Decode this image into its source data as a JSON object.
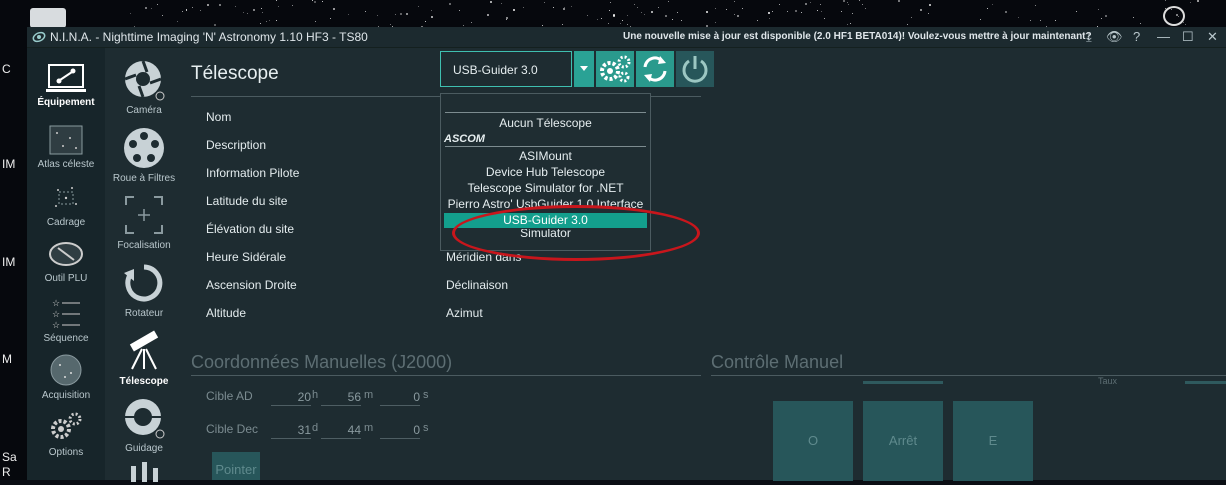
{
  "window": {
    "title": "N.I.N.A. - Nighttime Imaging 'N' Astronomy 1.10 HF3   -  TS80",
    "update_notice": "Une nouvelle mise à jour est disponible (2.0 HF1 BETA014)! Voulez-vous mettre à jour maintenant?"
  },
  "desktop": {
    "labels": [
      "C",
      "IM",
      "IM",
      "M",
      "Sa",
      "R"
    ]
  },
  "nav_primary": [
    {
      "label": "Équipement",
      "icon": "equipment-icon",
      "active": true
    },
    {
      "label": "Atlas céleste",
      "icon": "sky-atlas-icon"
    },
    {
      "label": "Cadrage",
      "icon": "framing-icon"
    },
    {
      "label": "Outil PLU",
      "icon": "flat-wizard-icon"
    },
    {
      "label": "Séquence",
      "icon": "sequence-icon"
    },
    {
      "label": "Acquisition",
      "icon": "imaging-icon"
    },
    {
      "label": "Options",
      "icon": "options-icon"
    }
  ],
  "nav_secondary": [
    {
      "label": "Caméra",
      "icon": "camera-icon"
    },
    {
      "label": "Roue à Filtres",
      "icon": "filter-wheel-icon"
    },
    {
      "label": "Focalisation",
      "icon": "focuser-icon"
    },
    {
      "label": "Rotateur",
      "icon": "rotator-icon"
    },
    {
      "label": "Télescope",
      "icon": "telescope-icon",
      "active": true
    },
    {
      "label": "Guidage",
      "icon": "guider-icon"
    }
  ],
  "page": {
    "title": "Télescope",
    "device_select": {
      "value": "USB-Guider 3.0"
    },
    "info_left": [
      "Nom",
      "Description",
      "Information Pilote",
      "Latitude du site",
      "Élévation du site",
      "Heure Sidérale",
      "Ascension Droite",
      "Altitude"
    ],
    "info_right": [
      "Méridien dans",
      "Déclinaison",
      "Azimut"
    ]
  },
  "dropdown": {
    "none_item": "Aucun Télescope",
    "group_header": "ASCOM",
    "items": [
      "ASIMount",
      "Device Hub Telescope",
      "Telescope Simulator for .NET",
      "Pierro Astro' UsbGuider 1.0 Interface",
      "USB-Guider 3.0",
      "Simulator"
    ],
    "selected_index": 4
  },
  "manual_coords": {
    "title": "Coordonnées Manuelles (J2000)",
    "ra_label": "Cible AD",
    "ra": {
      "h": "20",
      "h_unit": "h",
      "m": "56",
      "m_unit": "m",
      "s": "0",
      "s_unit": "s"
    },
    "dec_label": "Cible Dec",
    "dec": {
      "d": "31",
      "d_unit": "d",
      "m": "44",
      "m_unit": "m",
      "s": "0",
      "s_unit": "s"
    },
    "slew_button": "Pointer"
  },
  "manual_control": {
    "title": "Contrôle Manuel",
    "rate_label": "Taux",
    "west_button": "O",
    "stop_button": "Arrêt",
    "east_button": "E"
  },
  "colors": {
    "accent": "#2a9a8d",
    "selection": "#139f8d",
    "highlight_ellipse": "#c8161c"
  }
}
